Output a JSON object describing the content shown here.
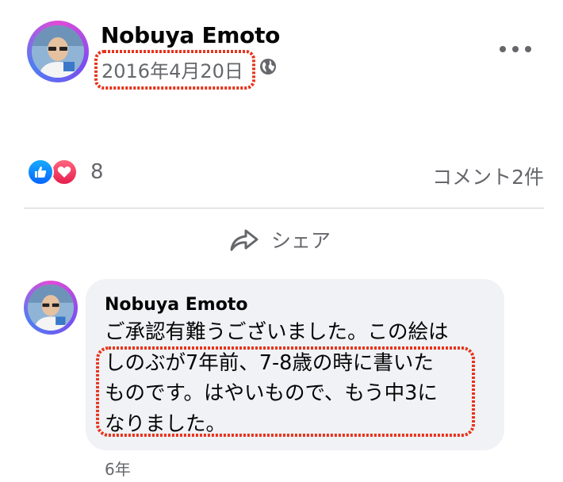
{
  "post": {
    "author": "Nobuya Emoto",
    "date": "2016年4月20日",
    "privacy_icon": "globe-icon",
    "more_icon": "more-horizontal-icon"
  },
  "reactions": {
    "icons": [
      "like-icon",
      "love-icon"
    ],
    "count": "8"
  },
  "comments_summary": "コメント2件",
  "actions": {
    "share_label": "シェア"
  },
  "comment": {
    "author": "Nobuya Emoto",
    "lines": [
      "ご承認有難うございました。この絵は",
      "しのぶが7年前、7-8歳の時に書いた",
      "ものです。はやいもので、もう中3に",
      "なりました。"
    ],
    "time": "6年"
  },
  "colors": {
    "secondary_text": "#65676b",
    "bubble_bg": "#f0f2f5",
    "like_blue": "#0866ff",
    "love_red": "#e61e4d",
    "annotation_red": "#e8331c"
  }
}
